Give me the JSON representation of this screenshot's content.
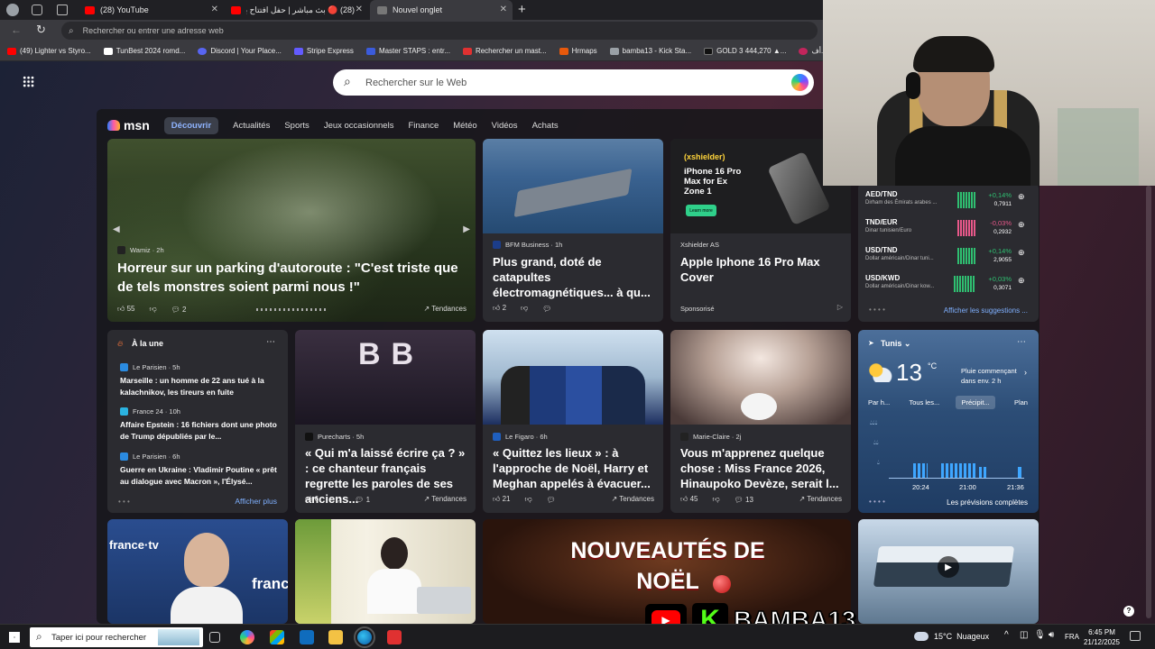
{
  "tabs": [
    {
      "label": "(28) YouTube",
      "active": false
    },
    {
      "label": "(28) 🔴 بث مباشر | حفل افتتاح بط...",
      "active": false
    },
    {
      "label": "Nouvel onglet",
      "active": true
    }
  ],
  "address_placeholder": "Rechercher ou entrer une adresse web",
  "bookmarks": [
    {
      "label": "(49) Lighter vs Styro...",
      "color": "#ff0000"
    },
    {
      "label": "TunBest 2024 romd...",
      "color": "#ffffff"
    },
    {
      "label": "Discord | Your Place...",
      "color": "#5865f2"
    },
    {
      "label": "Stripe Express",
      "color": "#635bff"
    },
    {
      "label": "Master STAPS : entr...",
      "color": "#3b5bdb"
    },
    {
      "label": "Rechercher un mast...",
      "color": "#e03131"
    },
    {
      "label": "Hrmaps",
      "color": "#e8590c"
    },
    {
      "label": "bamba13 - Kick Sta...",
      "color": "#9aa0a6"
    },
    {
      "label": "GOLD 3 444,270 ▲...",
      "color": "#111111"
    },
    {
      "label": "أف... | Shofha",
      "color": "#c2255c"
    }
  ],
  "search_placeholder": "Rechercher sur le Web",
  "msn": {
    "logo": "msn",
    "nav": [
      "Découvrir",
      "Actualités",
      "Sports",
      "Jeux occasionnels",
      "Finance",
      "Météo",
      "Vidéos",
      "Achats"
    ]
  },
  "hero": {
    "source": "Wamiz · 2h",
    "title": "Horreur sur un parking d'autoroute : \"C'est triste que de tels monstres soient parmi nous !\"",
    "likes": "55",
    "comments": "2",
    "trend": "Tendances"
  },
  "bfm": {
    "source": "BFM Business · 1h",
    "title": "Plus grand, doté de catapultes électromagnétiques... à qu...",
    "likes": "2"
  },
  "ad": {
    "brand_tag": "(xshielder)",
    "headline": "iPhone 16 Pro Max for Ex Zone 1",
    "button": "Learn more",
    "source": "Xshielder AS",
    "title": "Apple Iphone 16 Pro Max Cover",
    "sponsored": "Sponsorisé"
  },
  "stocks": {
    "items": [
      {
        "pair": "AED/TND",
        "desc": "Dirham des Émirats arabes ...",
        "change": "+0,14%",
        "value": "0,7911",
        "up": true
      },
      {
        "pair": "TND/EUR",
        "desc": "Dinar tunisien/Euro",
        "change": "-0,03%",
        "value": "0,2932",
        "up": false
      },
      {
        "pair": "USD/TND",
        "desc": "Dollar américain/Dinar tuni...",
        "change": "+0,14%",
        "value": "2,9055",
        "up": true
      },
      {
        "pair": "USD/KWD",
        "desc": "Dollar américain/Dinar kow...",
        "change": "+0,03%",
        "value": "0,3071",
        "up": true
      }
    ],
    "more": "Afficher les suggestions ..."
  },
  "headlines": {
    "title": "À la une",
    "items": [
      {
        "source": "Le Parisien · 5h",
        "text": "Marseille : un homme de 22 ans tué à la kalachnikov, les tireurs en fuite"
      },
      {
        "source": "France 24 · 10h",
        "text": "Affaire Epstein : 16 fichiers dont une photo de Trump dépubliés par le..."
      },
      {
        "source": "Le Parisien · 6h",
        "text": "Guerre en Ukraine : Vladimir Poutine « prêt au dialogue avec Macron », l'Élysé..."
      }
    ],
    "more": "Afficher plus"
  },
  "cards": [
    {
      "source": "Purecharts · 5h",
      "title": "« Qui m'a laissé écrire ça ? » : ce chanteur français regrette les paroles de ses anciens...",
      "likes": "6",
      "comments": "1",
      "trend": "Tendances"
    },
    {
      "source": "Le Figaro · 6h",
      "title": "« Quittez les lieux » : à l'approche de Noël, Harry et Meghan appelés à évacuer...",
      "likes": "21",
      "comments": "",
      "trend": "Tendances"
    },
    {
      "source": "Marie-Claire · 2j",
      "title": "Vous m'apprenez quelque chose : Miss France 2026, Hinaupoko Devèze, serait l...",
      "likes": "45",
      "comments": "13",
      "trend": "Tendances"
    }
  ],
  "weather": {
    "city": "Tunis",
    "temp": "13",
    "unit": "°C",
    "desc": "Pluie commençant dans env. 2 h",
    "tabs": [
      "Par h...",
      "Tous les...",
      "Précipit...",
      "Plan"
    ],
    "times": [
      "20:24",
      "21:00",
      "21:36"
    ],
    "more": "Les prévisions complètes"
  },
  "bottom_banner": "NOUVEAUTÉS DE NOËL",
  "bottom_tv": "france·tv",
  "streamer": "BAMBA13",
  "taskbar": {
    "search": "Taper ici pour rechercher",
    "weather": "15°C  Nuageux",
    "lang": "FRA",
    "time": "6:45 PM",
    "date": "21/12/2025"
  }
}
